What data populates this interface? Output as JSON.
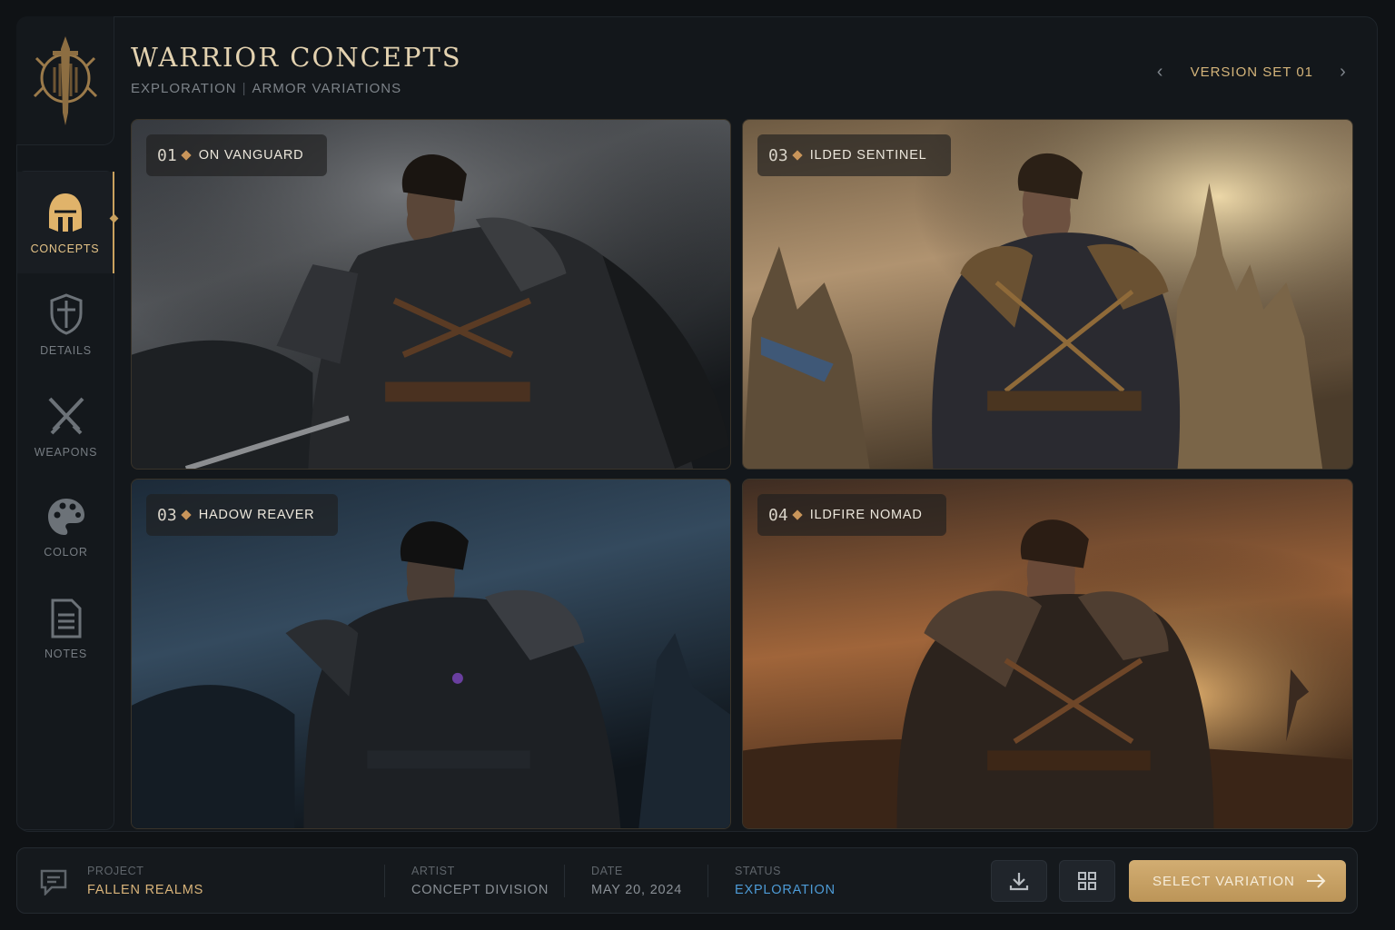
{
  "header": {
    "title": "WARRIOR CONCEPTS",
    "subtitle_a": "EXPLORATION",
    "subtitle_sep": "|",
    "subtitle_b": "ARMOR VARIATIONS",
    "version_label": "VERSION SET 01"
  },
  "sidebar": {
    "items": [
      {
        "label": "CONCEPTS",
        "icon": "helmet-icon",
        "active": true
      },
      {
        "label": "DETAILS",
        "icon": "shield-icon"
      },
      {
        "label": "WEAPONS",
        "icon": "crossed-swords-icon"
      },
      {
        "label": "COLOR",
        "icon": "palette-icon"
      },
      {
        "label": "NOTES",
        "icon": "document-icon"
      }
    ]
  },
  "cards": [
    {
      "num": "01",
      "name": "ON VANGUARD"
    },
    {
      "num": "03",
      "name": "ILDED SENTINEL"
    },
    {
      "num": "03",
      "name": "HADOW REAVER"
    },
    {
      "num": "04",
      "name": "ILDFIRE NOMAD"
    }
  ],
  "footer": {
    "project_label": "PROJECT",
    "project_value": "FALLEN REALMS",
    "artist_label": "ARTIST",
    "artist_value": "CONCEPT DIVISION",
    "date_label": "DATE",
    "date_value": "MAY 20, 2024",
    "status_label": "STATUS",
    "status_value": "EXPLORATION",
    "select_label": "SELECT VARIATION"
  },
  "colors": {
    "accent_gold": "#d4b47a",
    "status_blue": "#4d9bd6",
    "background": "#0f1215"
  }
}
